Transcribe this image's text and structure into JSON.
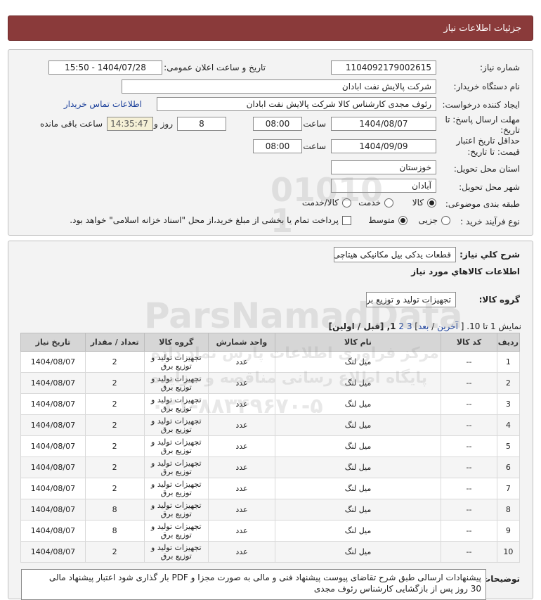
{
  "header": {
    "title": "جزئیات اطلاعات نیاز"
  },
  "info": {
    "need_number_label": "شماره نیاز:",
    "need_number": "1104092179002615",
    "announce_label": "تاریخ و ساعت اعلان عمومی:",
    "announce_value": "1404/07/28 - 15:50",
    "buyer_org_label": "نام دستگاه خریدار:",
    "buyer_org": "شرکت پالایش نفت ابادان",
    "creator_label": "ایجاد کننده درخواست:",
    "creator": "رئوف مجدی کارشناس کالا شرکت پالایش نفت ابادان",
    "contact_link": "اطلاعات تماس خریدار",
    "reply_label_1": "مهلت ارسال پاسخ: تا",
    "reply_label_2": "تاریخ:",
    "reply_date": "1404/08/07",
    "time_label": "ساعت",
    "reply_time": "08:00",
    "days_value": "8",
    "days_label": "روز و",
    "remaining_time": "14:35:47",
    "remaining_label": "ساعت باقی مانده",
    "validity_label_1": "حداقل تاریخ اعتبار",
    "validity_label_2": "قیمت: تا تاریخ:",
    "validity_date": "1404/09/09",
    "validity_time": "08:00",
    "province_label": "استان محل تحویل:",
    "province": "خوزستان",
    "city_label": "شهر محل تحویل:",
    "city": "آبادان",
    "category_label": "طبقه بندی موضوعی:",
    "category_options": [
      "کالا",
      "خدمت",
      "کالا/خدمت"
    ],
    "process_label": "نوع فرآیند خرید :",
    "process_options": [
      "جزیی",
      "متوسط"
    ],
    "payment_note": "پرداخت تمام یا بخشی از مبلغ خرید،از محل \"اسناد خزانه اسلامی\" خواهد بود."
  },
  "details": {
    "summary_label": "شرح کلي نياز:",
    "summary": "قطعات يدکی بیل مکانیکی هیتاچی",
    "goods_info_title": "اطلاعات کالاهاي مورد نياز",
    "group_label": "گروه کالا:",
    "group_value": "تجهیزات تولید و توزیع برق",
    "pagination_prefix": "نمایش 1 تا 10. [",
    "pag_last": "آخرین",
    "pag_next": "بعد",
    "pag_3": "3",
    "pag_2": "2",
    "pag_rest": "1, [قبل / اولین]",
    "buyer_notes_label": "توضیحات خریدار:",
    "buyer_notes_line1": "پیشنهادات ارسالی طبق شرح تقاضای پیوست پیشنهاد فنی و مالی به صورت مجزا و PDF بار گذاری شود اعتبار پیشنهاد مالی",
    "buyer_notes_line2": "30 روز پس از بازگشایی کارشناس رئوف مجدی"
  },
  "table": {
    "headers": [
      "ردیف",
      "کد کالا",
      "نام کالا",
      "واحد شمارش",
      "گروه کالا",
      "تعداد / مقدار",
      "تاریخ نیاز"
    ],
    "rows": [
      [
        "1",
        "--",
        "میل لنگ",
        "عدد",
        "تجهیزات تولید و توزیع برق",
        "2",
        "1404/08/07"
      ],
      [
        "2",
        "--",
        "میل لنگ",
        "عدد",
        "تجهیزات تولید و توزیع برق",
        "2",
        "1404/08/07"
      ],
      [
        "3",
        "--",
        "میل لنگ",
        "عدد",
        "تجهیزات تولید و توزیع برق",
        "2",
        "1404/08/07"
      ],
      [
        "4",
        "--",
        "میل لنگ",
        "عدد",
        "تجهیزات تولید و توزیع برق",
        "2",
        "1404/08/07"
      ],
      [
        "5",
        "--",
        "میل لنگ",
        "عدد",
        "تجهیزات تولید و توزیع برق",
        "2",
        "1404/08/07"
      ],
      [
        "6",
        "--",
        "میل لنگ",
        "عدد",
        "تجهیزات تولید و توزیع برق",
        "2",
        "1404/08/07"
      ],
      [
        "7",
        "--",
        "میل لنگ",
        "عدد",
        "تجهیزات تولید و توزیع برق",
        "2",
        "1404/08/07"
      ],
      [
        "8",
        "--",
        "میل لنگ",
        "عدد",
        "تجهیزات تولید و توزیع برق",
        "8",
        "1404/08/07"
      ],
      [
        "9",
        "--",
        "میل لنگ",
        "عدد",
        "تجهیزات تولید و توزیع برق",
        "8",
        "1404/08/07"
      ],
      [
        "10",
        "--",
        "میل لنگ",
        "عدد",
        "تجهیزات تولید و توزیع برق",
        "2",
        "1404/08/07"
      ]
    ]
  },
  "watermark": {
    "brand": "ParsNamadData",
    "digits": "010101",
    "line1": "مرکز فراوری اطلاعات پارس نماد داده",
    "line2": "پایگاه اطلاع رسانی مناقصه و مزایده",
    "phone": "۰۲۱-۸۸۳۴۹۶۷۰-۵"
  },
  "colors": {
    "header_bg": "#8a3a3a",
    "panel_bg": "#f3f3f3",
    "link": "#1a3f9a"
  }
}
